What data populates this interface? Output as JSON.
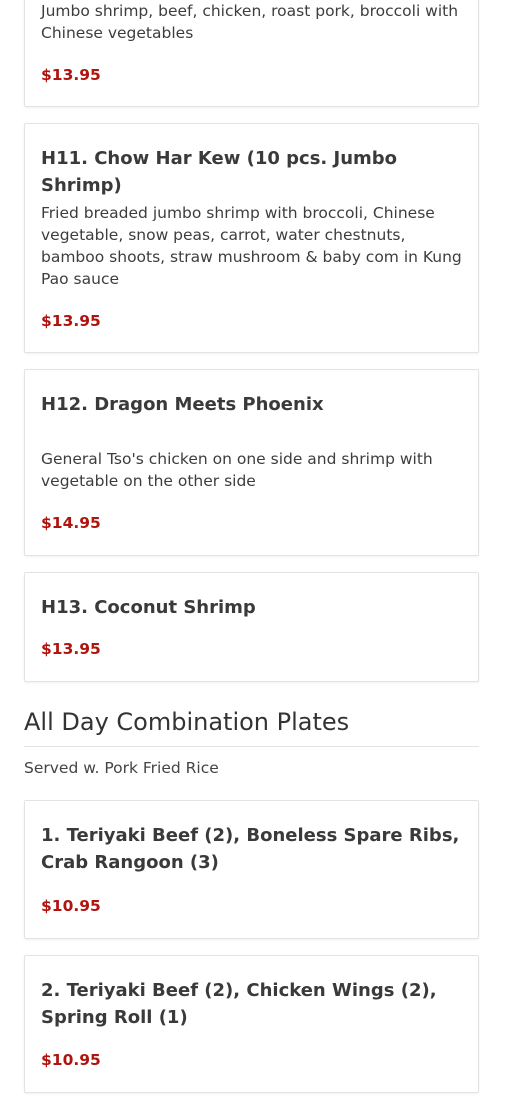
{
  "menu": {
    "items_top": [
      {
        "title": "",
        "description": "Jumbo shrimp, beef, chicken, roast pork, broccoli with Chinese vegetables",
        "price": "$13.95"
      },
      {
        "title": "H11. Chow Har Kew (10 pcs. Jumbo Shrimp)",
        "description": "Fried breaded jumbo shrimp with broccoli, Chinese vegetable, snow peas, carrot, water chestnuts, bamboo shoots, straw mushroom & baby com in Kung Pao sauce",
        "price": "$13.95"
      },
      {
        "title": "H12. Dragon Meets Phoenix",
        "description": "General Tso's chicken on one side and shrimp with vegetable on the other side",
        "price": "$14.95"
      },
      {
        "title": "H13. Coconut Shrimp",
        "description": "",
        "price": "$13.95"
      }
    ],
    "section": {
      "title": "All Day Combination Plates",
      "subtitle": "Served w. Pork Fried Rice"
    },
    "items_bottom": [
      {
        "title": "1. Teriyaki Beef (2), Boneless Spare Ribs, Crab Rangoon (3)",
        "price": "$10.95"
      },
      {
        "title": "2. Teriyaki Beef (2), Chicken Wings (2), Spring Roll (1)",
        "price": "$10.95"
      }
    ]
  },
  "colors": {
    "price": "#b0140f",
    "border": "#e3e3e3",
    "text": "#333333"
  }
}
